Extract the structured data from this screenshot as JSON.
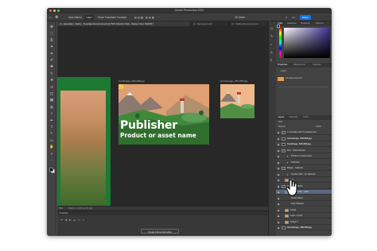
{
  "app": {
    "window_title": "Adobe Photoshop 2022",
    "share_label": "Share"
  },
  "options_bar": {
    "auto_select": "Auto-Select:",
    "layer_mode": "Layer",
    "show_transform": "Show Transform Controls"
  },
  "doc_tabs": [
    {
      "label": "Ai - AssetHero_Starter_Template Recovered.psd @ 50% (Double Click - Badge Color, RGB/8) *"
    },
    {
      "label": "Ai - Recovered.psd"
    },
    {
      "label": "Ai - Outline Recovered.psd"
    }
  ],
  "canvas": {
    "artboard_main_label": "Cardimage_620x328.jpg",
    "artboard_small_label": "Homeimage_780x780.jpg",
    "publisher_title": "Publisher",
    "publisher_subtitle": "Product or asset name"
  },
  "status": {
    "zoom": "50%",
    "doc_info": "1519 px x 1116 px (72 ppi)"
  },
  "timeline": {
    "title": "Timeline",
    "create_button": "Create Frame Animation"
  },
  "panels": {
    "color_tabs": [
      "Color",
      "Swatches",
      "Gradients",
      "Patterns"
    ],
    "properties_tabs": [
      "Properties",
      "Adjustments",
      "Libraries"
    ],
    "properties_content": "Layer",
    "libraries_item": "All areas selected",
    "layers_tabs": [
      "Layers",
      "Channels",
      "Paths"
    ],
    "kind_filter": "Kind",
    "blend_mode": "Normal",
    "opacity": "100%",
    "layers": [
      {
        "name": "1.1 Double Click To Update Icon",
        "type": "group"
      },
      {
        "name": "Homeimage_780x780.jpg",
        "type": "artboard"
      },
      {
        "name": "Cardimage_620x328.jpg",
        "type": "artboard"
      },
      {
        "name": "Text - Optional Area",
        "type": "group"
      },
      {
        "name": "Product or asset name",
        "type": "text"
      },
      {
        "name": "Publisher",
        "type": "text"
      },
      {
        "name": "Badge - Optional",
        "type": "group"
      },
      {
        "name": "Double Click - for Optional",
        "type": "text"
      },
      {
        "name": "BG",
        "type": "layer"
      },
      {
        "name": "Photoshop Mode",
        "type": "group"
      },
      {
        "name": "Double Click - Color",
        "type": "selected"
      },
      {
        "name": "Smart Filters",
        "type": "effect"
      },
      {
        "name": "Drop Shadow",
        "type": "effect"
      },
      {
        "name": "Image",
        "type": "layer"
      },
      {
        "name": "Layer 1 (text)",
        "type": "layer"
      },
      {
        "name": "Image 0",
        "type": "layer"
      },
      {
        "name": "Homeimage_780x780.jpg",
        "type": "artboard"
      }
    ]
  },
  "tools": [
    "move-icon",
    "marquee-icon",
    "lasso-icon",
    "magic-wand-icon",
    "crop-icon",
    "eyedropper-icon",
    "heal-icon",
    "brush-icon",
    "stamp-icon",
    "history-brush-icon",
    "eraser-icon",
    "gradient-icon",
    "blur-icon",
    "dodge-icon",
    "pen-icon",
    "type-icon",
    "path-select-icon",
    "shape-icon",
    "hand-icon",
    "zoom-icon",
    "more-icon"
  ],
  "colors": {
    "accent": "#1473e6",
    "selection": "#596a7f",
    "artboard_green": "#1c7a33"
  }
}
